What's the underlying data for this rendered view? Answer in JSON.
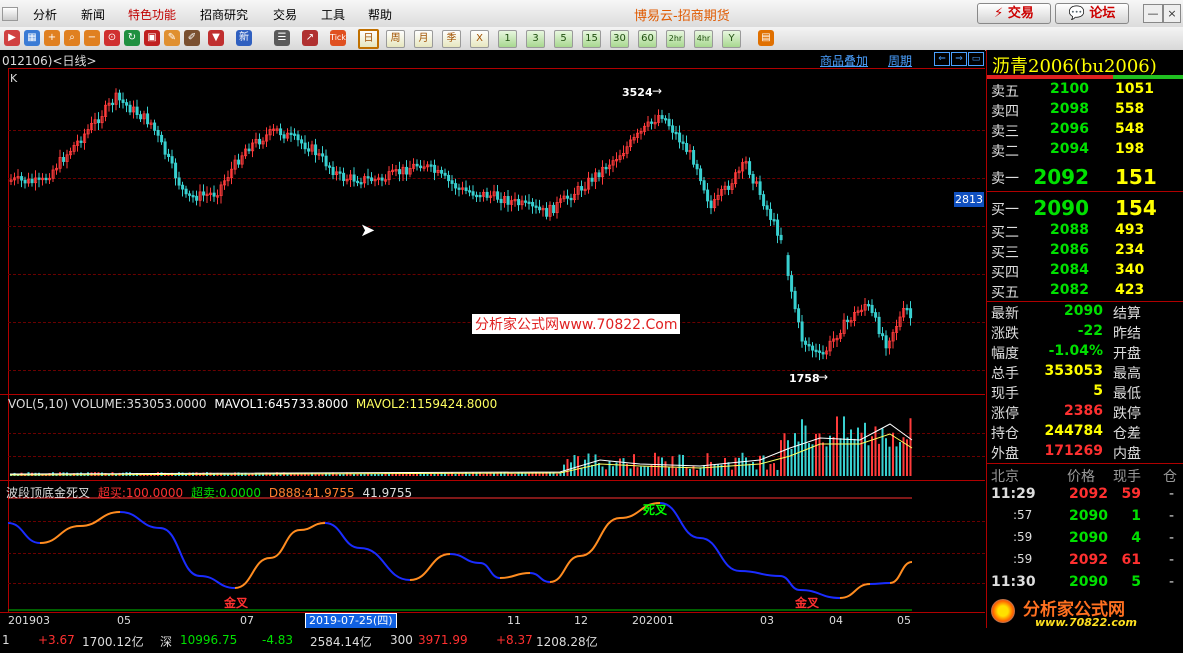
{
  "menu": {
    "items": [
      {
        "label": "分析",
        "x": 33
      },
      {
        "label": "新闻",
        "x": 81
      },
      {
        "label": "特色功能",
        "x": 128,
        "color": "#c00000"
      },
      {
        "label": "招商研究",
        "x": 200
      },
      {
        "label": "交易",
        "x": 273
      },
      {
        "label": "工具",
        "x": 321
      },
      {
        "label": "帮助",
        "x": 368
      }
    ],
    "brand": "博易云-招商期货",
    "trade_btn": "⚡ 交易",
    "forum_btn": "💬 论坛"
  },
  "toolbar": {
    "periods": [
      "日",
      "周",
      "月",
      "季",
      "X",
      "1",
      "3",
      "5",
      "15",
      "30",
      "60",
      "2hr",
      "4hr",
      "Y"
    ],
    "selected_period": "日"
  },
  "chart": {
    "header_left": "012106)<日线>",
    "overlay_link": "商品叠加",
    "period_link": "周期",
    "k_label": "K",
    "high_label": "3524",
    "low_label": "1758",
    "last_price_tag": "2813",
    "watermark": "分析家公式网www.70822.Com",
    "vol_title": "VOL(5,10) VOLUME:353053.0000",
    "vol_mavol1": "MAVOL1:645733.8000",
    "vol_mavol2": "MAVOL2:1159424.8000",
    "ind_title": "波段顶底金死叉",
    "ind_overbuy": "超买:100.0000",
    "ind_oversell": "超卖:0.0000",
    "ind_d888": "D888:41.9755",
    "ind_val": "41.9755",
    "death_cross": "死叉",
    "golden_cross_1": "金叉",
    "golden_cross_2": "金叉",
    "date_tooltip": "2019-07-25(四)",
    "x_ticks": [
      {
        "label": "201903",
        "x": 8
      },
      {
        "label": "05",
        "x": 117
      },
      {
        "label": "07",
        "x": 240
      },
      {
        "label": "11",
        "x": 507
      },
      {
        "label": "12",
        "x": 574
      },
      {
        "label": "202001",
        "x": 632
      },
      {
        "label": "03",
        "x": 760
      },
      {
        "label": "04",
        "x": 829
      },
      {
        "label": "05",
        "x": 897
      }
    ]
  },
  "quote": {
    "symbol": "沥青2006(bu2006)",
    "asks": [
      {
        "label": "卖五",
        "price": "2100",
        "vol": "1051"
      },
      {
        "label": "卖四",
        "price": "2098",
        "vol": "558"
      },
      {
        "label": "卖三",
        "price": "2096",
        "vol": "548"
      },
      {
        "label": "卖二",
        "price": "2094",
        "vol": "198"
      }
    ],
    "ask1": {
      "label": "卖一",
      "price": "2092",
      "vol": "151"
    },
    "bid1": {
      "label": "买一",
      "price": "2090",
      "vol": "154"
    },
    "bids": [
      {
        "label": "买二",
        "price": "2088",
        "vol": "493"
      },
      {
        "label": "买三",
        "price": "2086",
        "vol": "234"
      },
      {
        "label": "买四",
        "price": "2084",
        "vol": "340"
      },
      {
        "label": "买五",
        "price": "2082",
        "vol": "423"
      }
    ],
    "stats": [
      {
        "label": "最新",
        "value": "2090",
        "cls": "g",
        "right": "结算"
      },
      {
        "label": "涨跌",
        "value": "-22",
        "cls": "g",
        "right": "昨结"
      },
      {
        "label": "幅度",
        "value": "-1.04%",
        "cls": "g",
        "right": "开盘"
      },
      {
        "label": "总手",
        "value": "353053",
        "cls": "y",
        "right": "最高"
      },
      {
        "label": "现手",
        "value": "5",
        "cls": "y",
        "right": "最低"
      },
      {
        "label": "涨停",
        "value": "2386",
        "cls": "r",
        "right": "跌停"
      },
      {
        "label": "持仓",
        "value": "244784",
        "cls": "y",
        "right": "仓差"
      },
      {
        "label": "外盘",
        "value": "171269",
        "cls": "r",
        "right": "内盘"
      }
    ],
    "tick_header": {
      "place": "北京",
      "price": "价格",
      "hand": "现手",
      "pos": "仓"
    },
    "ticks": [
      {
        "time": "11:29",
        "price": "2092",
        "hand": "59",
        "pcls": "r",
        "hcls": "r",
        "dir": "-"
      },
      {
        "time": ":57",
        "price": "2090",
        "hand": "1",
        "pcls": "g",
        "hcls": "g",
        "dir": "-"
      },
      {
        "time": ":59",
        "price": "2090",
        "hand": "4",
        "pcls": "g",
        "hcls": "g",
        "dir": "-"
      },
      {
        "time": ":59",
        "price": "2092",
        "hand": "61",
        "pcls": "r",
        "hcls": "r",
        "dir": "-"
      },
      {
        "time": "11:30",
        "price": "2090",
        "hand": "5",
        "pcls": "g",
        "hcls": "g",
        "dir": "-"
      }
    ],
    "logo_text": "分析家公式网",
    "logo_url": "www.70822.com"
  },
  "status": {
    "s1": "1",
    "s2": "+3.67",
    "s3": "1700.12亿",
    "s4": "深",
    "s5": "10996.75",
    "s6": "-4.83",
    "s7": "2584.14亿",
    "s8": "300",
    "s9": "3971.99",
    "s10": "+8.37",
    "s11": "1208.28亿"
  }
}
